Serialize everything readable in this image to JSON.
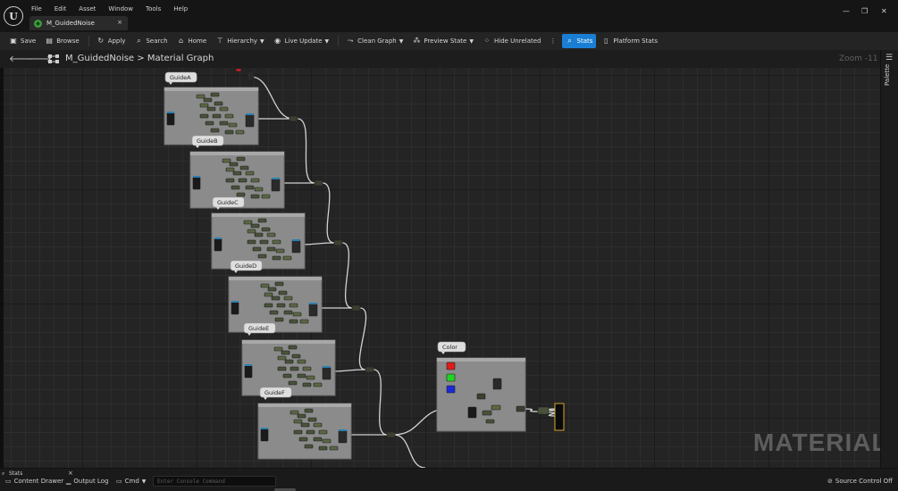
{
  "app": {
    "menu": [
      "File",
      "Edit",
      "Asset",
      "Window",
      "Tools",
      "Help"
    ],
    "tab_title": "M_GuidedNoise",
    "tab_close": "×",
    "window_controls": {
      "minimize": "—",
      "restore": "❐",
      "close": "✕"
    }
  },
  "toolbar": {
    "save": "Save",
    "browse": "Browse",
    "apply": "Apply",
    "search": "Search",
    "home": "Home",
    "hierarchy": "Hierarchy",
    "live_update": "Live Update",
    "clean_graph": "Clean Graph",
    "preview_state": "Preview State",
    "hide_unrelated": "Hide Unrelated",
    "more": "⋮",
    "stats": "Stats",
    "platform_stats": "Platform Stats",
    "active_color": "#1a7fd4"
  },
  "breadcrumb": {
    "asset": "M_GuidedNoise",
    "separator": ">",
    "graph": "Material Graph",
    "zoom": "Zoom -11"
  },
  "graph": {
    "comments": [
      "GuideA",
      "GuideB",
      "GuideC",
      "GuideD",
      "GuideE",
      "GuideF",
      "Color"
    ],
    "color_swatches": [
      "#e01b1b",
      "#22d322",
      "#1b2ad8"
    ],
    "watermark": "MATERIAL"
  },
  "palette": {
    "tab_label": "Palette"
  },
  "statusbar": {
    "stats_tab": "Stats",
    "stats_close": "×",
    "content_drawer": "Content Drawer",
    "output_log": "Output Log",
    "cmd": "Cmd",
    "console_placeholder": "Enter Console Command",
    "source_control": "Source Control Off"
  }
}
